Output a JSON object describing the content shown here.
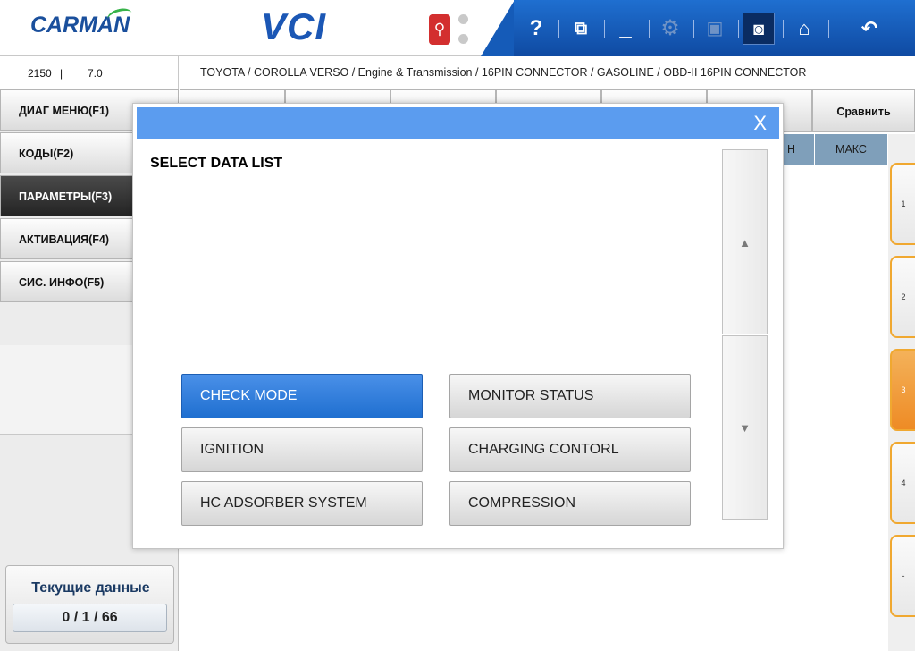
{
  "header": {
    "logo_text": "CARMAN",
    "app_name": "VCI",
    "usb_icon": "usb-icon",
    "toolbar": {
      "help": "?",
      "windows_icon": "windows-icon",
      "minimize_icon": "minimize-icon",
      "settings_icon": "settings-icon",
      "save_icon": "save-icon",
      "camera_icon": "camera-icon",
      "home_icon": "home-icon",
      "back_icon": "back-icon"
    },
    "accent_color": "#1b57b5"
  },
  "infobar": {
    "code": "2150",
    "separator": "|",
    "version": "7.0",
    "breadcrumb": "TOYOTA / COROLLA VERSO / Engine & Transmission / 16PIN CONNECTOR / GASOLINE / OBD-II 16PIN CONNECTOR"
  },
  "menu": {
    "items": [
      {
        "label": "ДИАГ МЕНЮ(F1)"
      },
      {
        "label": "КОДЫ(F2)"
      },
      {
        "label": "ПАРАМЕТРЫ(F3)"
      },
      {
        "label": "АКТИВАЦИЯ(F4)"
      },
      {
        "label": "СИС. ИНФО(F5)"
      }
    ]
  },
  "current_data": {
    "title": "Текущие данные",
    "count": "0 / 1 / 66"
  },
  "background": {
    "compare_button": "Сравнить",
    "col_min": "Н",
    "col_max": "МАКС",
    "side_tabs": [
      "1",
      "2",
      "3",
      "4",
      "-"
    ]
  },
  "modal": {
    "title": "SELECT DATA LIST",
    "close": "X",
    "scroll_up": "▲",
    "scroll_down": "▼",
    "options": [
      {
        "label": "CHECK MODE",
        "selected": true
      },
      {
        "label": "MONITOR STATUS",
        "selected": false
      },
      {
        "label": "IGNITION",
        "selected": false
      },
      {
        "label": "CHARGING CONTORL",
        "selected": false
      },
      {
        "label": "HC ADSORBER SYSTEM",
        "selected": false
      },
      {
        "label": "COMPRESSION",
        "selected": false
      }
    ],
    "titlebar_color": "#5b9cef",
    "selected_color": "#1f6fd0"
  }
}
